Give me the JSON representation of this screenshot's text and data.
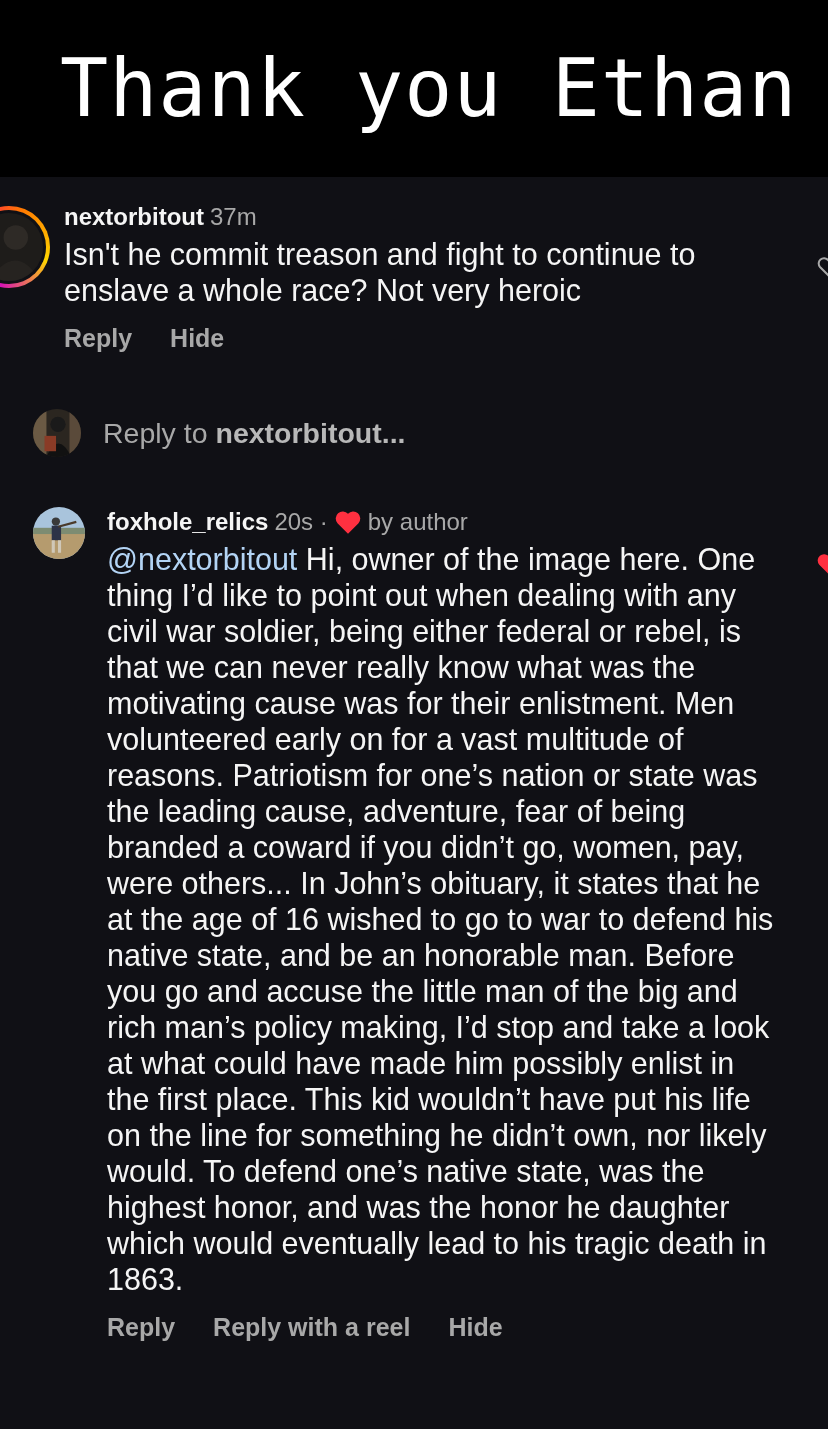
{
  "banner": {
    "title": "Thank you Ethan"
  },
  "comments": [
    {
      "username": "nextorbitout",
      "time": "37m",
      "story_ring": true,
      "liked": false,
      "body": "Isn't he commit treason and fight to continue to enslave a whole race? Not very heroic",
      "actions": [
        "Reply",
        "Hide"
      ]
    }
  ],
  "reply_prompt": {
    "prefix": "Reply to",
    "username": "nextorbitout..."
  },
  "replies": [
    {
      "username": "foxhole_relics",
      "time": "20s ·",
      "badge": "by author",
      "liked": true,
      "mention": "@nextorbitout",
      "body": "Hi, owner of the image here. One thing I’d like to point out when dealing with any civil war soldier, being either federal or rebel, is that we can never really know what was the motivating cause was for their enlistment. Men volunteered early on for a vast multitude of reasons. Patriotism for one’s nation or state was the leading cause, adventure, fear of being branded a coward if you didn’t go, women, pay, were others... In John’s obituary, it states that he at the age of 16 wished to go to war to defend his native state, and be an honorable man. Before you go and accuse the little man of the big and rich man’s policy making, I’d stop and take a look at what could have made him possibly enlist in the first place. This kid wouldn’t have put his life on the line for something he didn’t own, nor likely would. To defend one’s native state, was the highest honor, and was the honor he daughter which would eventually lead to his tragic death in 1863.",
      "actions": [
        "Reply",
        "Reply with a reel",
        "Hide"
      ]
    }
  ]
}
